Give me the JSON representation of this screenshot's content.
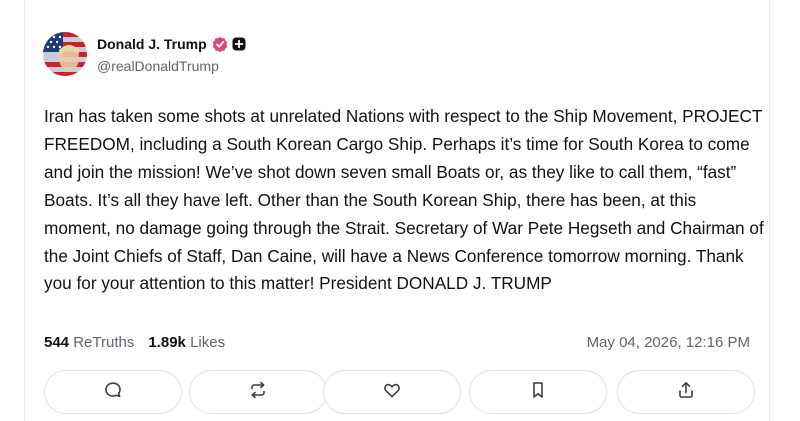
{
  "author": {
    "name": "Donald J. Trump",
    "handle": "@realDonaldTrump",
    "avatar_icon": "avatar-flag-portrait",
    "verified_color": "#e2447d"
  },
  "post": {
    "text": "Iran has taken some shots at unrelated Nations with respect to the Ship Movement, PROJECT FREEDOM, including a South Korean Cargo Ship. Perhaps it’s time for South Korea to come and join the mission! We’ve shot down seven small Boats or, as they like to call them, “fast” Boats. It’s all they have left. Other than the South Korean Ship, there has been, at this moment, no damage going through the Strait. Secretary of War Pete Hegseth and Chairman of the Joint Chiefs of Staff, Dan Caine, will have a News Conference tomorrow morning. Thank you for your attention to this matter! President DONALD J. TRUMP"
  },
  "stats": {
    "retruths_count": "544",
    "retruths_label": "ReTruths",
    "likes_count": "1.89k",
    "likes_label": "Likes",
    "timestamp": "May 04, 2026, 12:16 PM"
  },
  "actions": [
    {
      "icon": "reply-icon"
    },
    {
      "icon": "retruth-icon"
    },
    {
      "icon": "like-icon"
    },
    {
      "icon": "bookmark-icon"
    },
    {
      "icon": "share-icon"
    }
  ]
}
